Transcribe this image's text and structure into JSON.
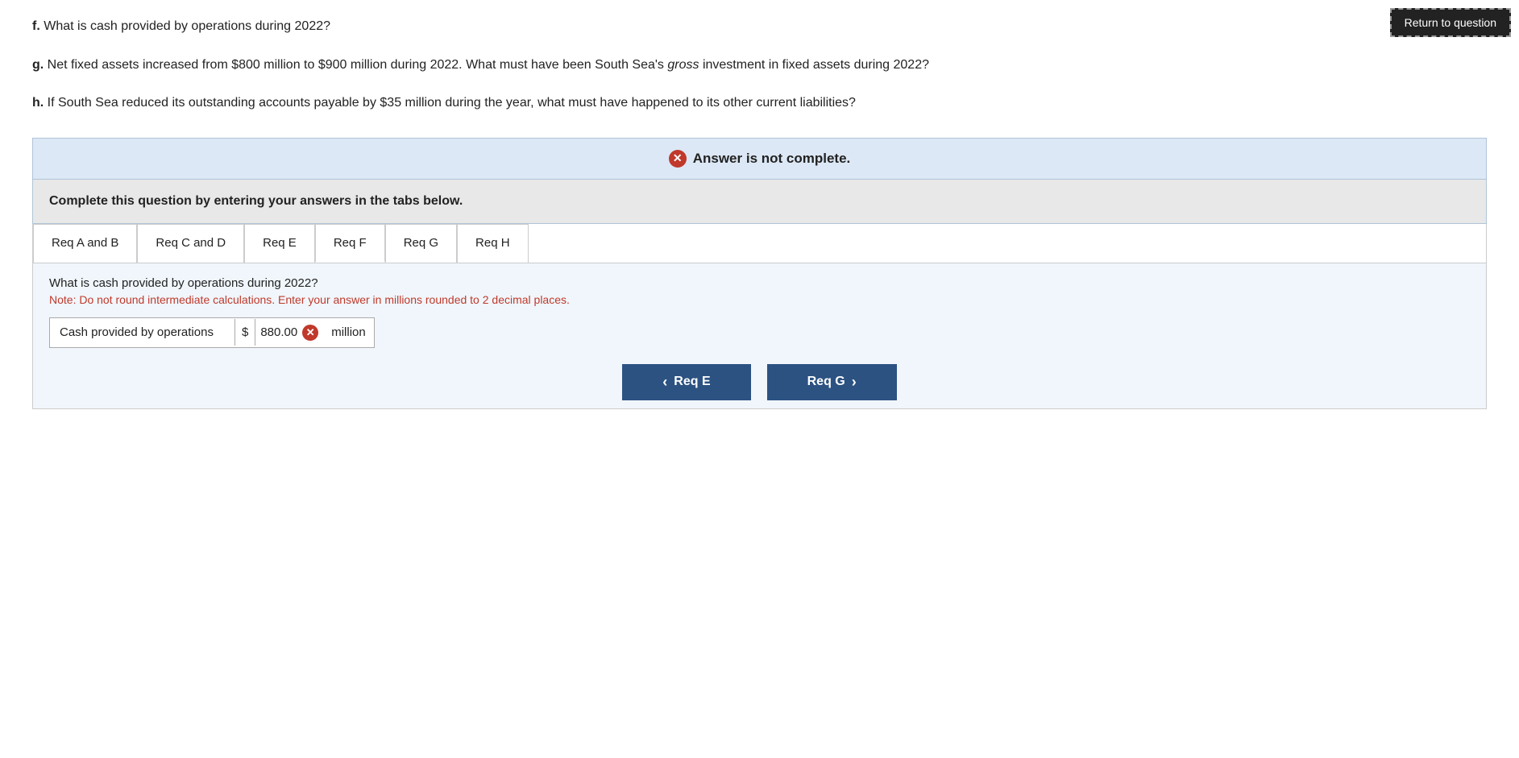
{
  "topButton": {
    "label": "Return to question"
  },
  "questions": {
    "f": {
      "label": "f.",
      "text": "What is cash provided by operations during 2022?"
    },
    "g": {
      "label": "g.",
      "text_before_italic": "Net fixed assets increased from $800 million to $900 million during 2022. What must have been South Sea's ",
      "italic": "gross",
      "text_after_italic": " investment in fixed assets during 2022?"
    },
    "h": {
      "label": "h.",
      "text": "If South Sea reduced its outstanding accounts payable by $35 million during the year, what must have happened to its other current liabilities?"
    }
  },
  "banner": {
    "icon": "✕",
    "text": "Answer is not complete."
  },
  "instruction": {
    "text": "Complete this question by entering your answers in the tabs below."
  },
  "tabs": [
    {
      "id": "req-a-b",
      "label": "Req A and B"
    },
    {
      "id": "req-c-d",
      "label": "Req C and D"
    },
    {
      "id": "req-e",
      "label": "Req E"
    },
    {
      "id": "req-f",
      "label": "Req F",
      "active": true
    },
    {
      "id": "req-g",
      "label": "Req G"
    },
    {
      "id": "req-h",
      "label": "Req H"
    }
  ],
  "tabContent": {
    "question": "What is cash provided by operations during 2022?",
    "note": "Note: Do not round intermediate calculations. Enter your answer in millions rounded to 2 decimal places.",
    "row": {
      "label": "Cash provided by operations",
      "dollar": "$",
      "value": "880.00",
      "unit": "million"
    }
  },
  "navButtons": {
    "prev": {
      "label": "Req E",
      "chevron": "‹"
    },
    "next": {
      "label": "Req G",
      "chevron": "›"
    }
  }
}
